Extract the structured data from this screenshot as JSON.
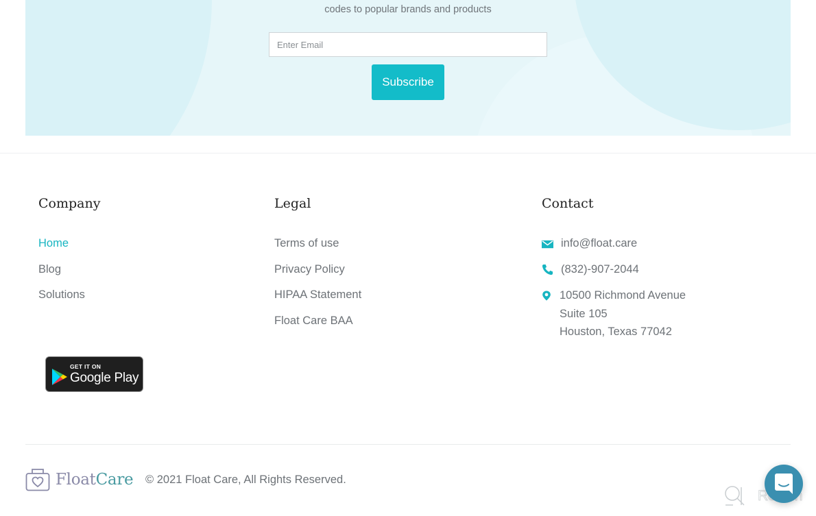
{
  "newsletter": {
    "subtitle": "codes to popular brands and products",
    "email_placeholder": "Enter Email",
    "email_value": "",
    "subscribe_label": "Subscribe"
  },
  "footer": {
    "company": {
      "heading": "Company",
      "links": [
        {
          "label": "Home",
          "active": true
        },
        {
          "label": "Blog",
          "active": false
        },
        {
          "label": "Solutions",
          "active": false
        }
      ]
    },
    "legal": {
      "heading": "Legal",
      "links": [
        {
          "label": "Terms of use"
        },
        {
          "label": "Privacy Policy"
        },
        {
          "label": "HIPAA Statement"
        },
        {
          "label": "Float Care BAA"
        }
      ]
    },
    "contact": {
      "heading": "Contact",
      "email": {
        "icon": "mail-icon",
        "value": "info@float.care"
      },
      "phone": {
        "icon": "phone-icon",
        "value": "(832)-907-2044"
      },
      "address": {
        "icon": "location-pin-icon",
        "lines": [
          "10500 Richmond Avenue",
          "Suite 105",
          "Houston, Texas 77042"
        ]
      }
    },
    "google_play": {
      "small": "GET IT ON",
      "big": "Google Play"
    },
    "logo": {
      "part1": "Float",
      "part2": "Care"
    },
    "copyright": "© 2021 Float Care, All Rights Reserved.",
    "watermark": "Revain"
  },
  "colors": {
    "accent": "#13bcc9",
    "link_active": "#17b5c1",
    "text_muted": "#6d7277",
    "newsletter_bg": "#e6f6f9",
    "chat_button": "#3a8fb0"
  }
}
